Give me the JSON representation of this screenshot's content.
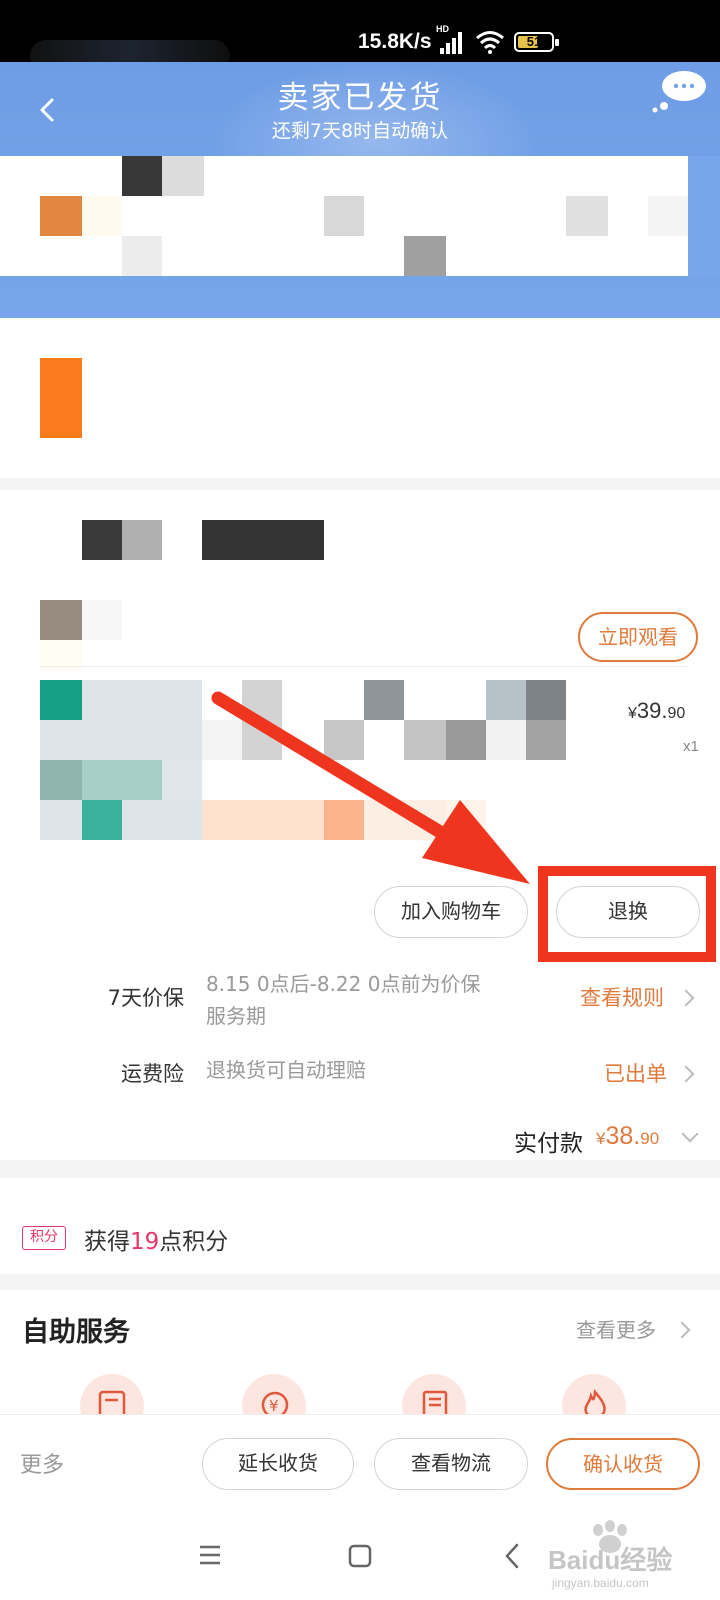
{
  "status_bar": {
    "speed": "15.8K/s",
    "network": "HD",
    "battery": "51"
  },
  "header": {
    "title": "卖家已发货",
    "subtitle": "还剩7天8时自动确认"
  },
  "product": {
    "watch_button": "立即观看",
    "price_symbol": "¥",
    "price_int": "39.",
    "price_dec": "90",
    "quantity": "x1",
    "add_cart_button": "加入购物车",
    "return_button": "退换"
  },
  "price_protect": {
    "label": "7天价保",
    "desc": "8.15 0点后-8.22 0点前为价保服务期",
    "link": "查看规则"
  },
  "shipping_insurance": {
    "label": "运费险",
    "desc": "退换货可自动理赔",
    "link": "已出单"
  },
  "payment": {
    "label": "实付款",
    "symbol": "¥",
    "amount_int": "38.",
    "amount_dec": "90"
  },
  "points": {
    "tag": "积分",
    "prefix": "获得",
    "value": "19",
    "suffix": "点积分"
  },
  "self_service": {
    "title": "自助服务",
    "see_more": "查看更多"
  },
  "action_bar": {
    "more": "更多",
    "extend_button": "延长收货",
    "logistics_button": "查看物流",
    "confirm_button": "确认收货"
  },
  "watermark": {
    "brand": "Baidu经验",
    "url": "jingyan.baidu.com"
  },
  "colors": {
    "header_blue": "#74a2ea",
    "accent_orange": "#e07a3c",
    "points_pink": "#e8366b",
    "annotation_red": "#f0351e"
  }
}
